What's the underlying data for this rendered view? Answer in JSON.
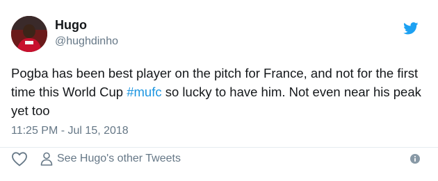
{
  "tweet": {
    "author_name": "Hugo",
    "author_handle": "@hughdinho",
    "text_before": "Pogba has been best player on the pitch for France, and not for the first time this World Cup ",
    "hashtag": "#mufc",
    "text_after": " so lucky to have him. Not even near his peak yet too",
    "timestamp": "11:25 PM - Jul 15, 2018",
    "other_tweets_label": "See Hugo's other Tweets"
  },
  "icons": {
    "brand": "twitter-bird-icon",
    "like": "heart-icon",
    "profile": "person-icon",
    "info": "info-icon"
  },
  "colors": {
    "twitter_blue": "#1da1f2",
    "hashtag": "#1b95e0",
    "secondary_text": "#657786",
    "primary_text": "#14171a"
  }
}
